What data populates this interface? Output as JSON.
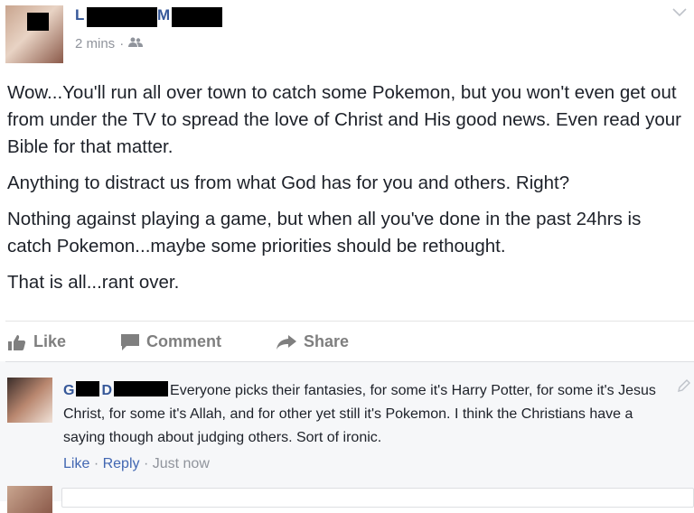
{
  "post": {
    "time": "2 mins",
    "separator": "·",
    "audience_icon": "friends-icon",
    "paragraphs": [
      "Wow...You'll run all over town to catch some Pokemon, but you won't even get out from under the TV to spread the love of Christ and His good news. Even read your Bible for that matter.",
      "Anything to distract us from what God has for you and others. Right?",
      "Nothing against playing a game, but when all you've done in the past 24hrs is catch Pokemon...maybe some priorities should be rethought.",
      "That is all...rant over."
    ]
  },
  "author": {
    "name_visible_1": "L",
    "name_visible_2": "M"
  },
  "actions": {
    "like": "Like",
    "comment": "Comment",
    "share": "Share"
  },
  "comment": {
    "author_visible_1": "G",
    "author_visible_2": "D",
    "text": "Everyone picks their fantasies, for some it's Harry Potter, for some it's Jesus Christ, for some it's Allah, and for other yet still it's Pokemon. I think the Christians have a saying though about judging others. Sort of ironic.",
    "like": "Like",
    "reply": "Reply",
    "time": "Just now",
    "sep": "·"
  },
  "colors": {
    "link": "#365899",
    "muted": "#90949c",
    "action": "#7f7f7f",
    "comment_bg": "#f6f7f9"
  }
}
